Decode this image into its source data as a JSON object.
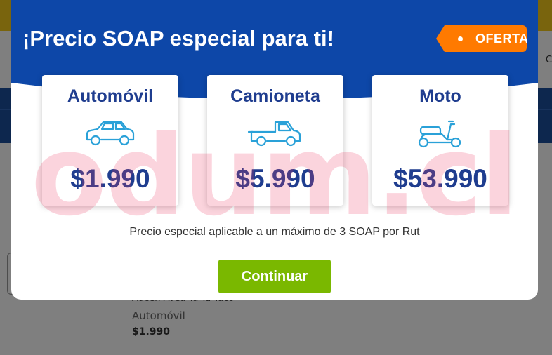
{
  "background": {
    "header_text": "C",
    "item_title": "Aucen Avea Ta Ta Taco",
    "item_type": "Automóvil",
    "item_price": "$1.990"
  },
  "modal": {
    "title": "¡Precio SOAP especial para ti!",
    "badge": "OFERTA",
    "cards": [
      {
        "title": "Automóvil",
        "icon": "car-icon",
        "price": "$1.990"
      },
      {
        "title": "Camioneta",
        "icon": "pickup-truck-icon",
        "price": "$5.990"
      },
      {
        "title": "Moto",
        "icon": "scooter-icon",
        "price": "$53.990"
      }
    ],
    "note": "Precio especial aplicable a un máximo de 3 SOAP por Rut",
    "continue_label": "Continuar"
  },
  "watermark": "odum.cl",
  "colors": {
    "modal_blue": "#0d47a8",
    "title_navy": "#1f3d8f",
    "badge_orange": "#ff7a00",
    "button_green": "#7ab800",
    "icon_blue": "#2aa1d8"
  }
}
